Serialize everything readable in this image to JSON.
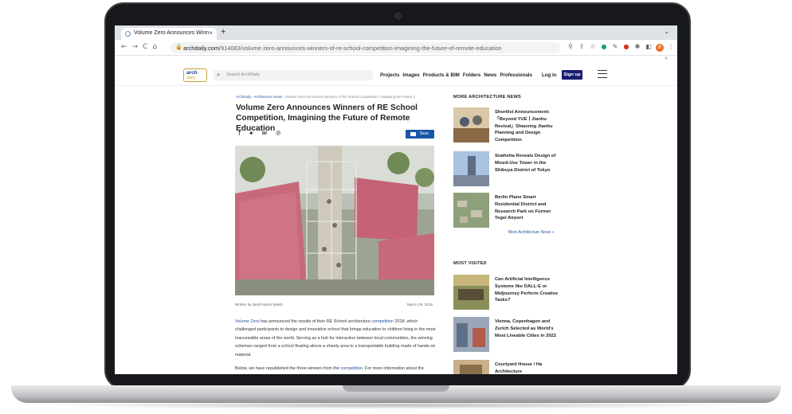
{
  "browser": {
    "tab_title": "Volume Zero Announces Winn",
    "tab_close": "×",
    "new_tab": "+",
    "url_host": "archdaily.com",
    "url_path": "/914083/volume-zero-announces-winners-of-re-school-competition-imagining-the-future-of-remote-education",
    "ext_badge": "B"
  },
  "site": {
    "logo_top": "arch",
    "logo_bottom": "daily",
    "search_placeholder": "Search ArchDaily",
    "nav": [
      "Projects",
      "Images",
      "Products & BIM",
      "Folders",
      "News",
      "Professionals"
    ],
    "login": "Log in",
    "signup": "Sign up"
  },
  "article": {
    "breadcrumb": [
      "ArchDaily",
      "Architecture News",
      "Volume Zero Announces Winners of RE School Competition, Imagining the Future o"
    ],
    "title": "Volume Zero Announces Winners of RE School Competition, Imagining the Future of Remote Education",
    "save_label": "Save",
    "byline": "Written by Niall Patrick Walsh",
    "date": "March 29, 2019",
    "p1_link1": "Volume Zero",
    "p1_text1": " has announced the results of their RE School architecture ",
    "p1_link2": "competition",
    "p1_text2": " 2018, which challenged participants to design and innovative school that brings education to children living in the most inaccessible areas of the world. Serving as a hub for interaction between local communities, the winning schemes ranged from a school floating above a shanty area to a transportable building made of hands-on material.",
    "p2_text": "Below, we have republished the three winners from the ",
    "p2_link": "competition",
    "p2_tail": ". For more information about the"
  },
  "sidebar": {
    "more_heading": "MORE ARCHITECTURE NEWS",
    "more_items": [
      "Shortlist Announcement: 「Beyond YUE丨Jianhu Revival」Shaoxing Jianhu Planning and Design Competition",
      "Snøhetta Reveals Design of Mixed-Use Tower in the Shibuya District of Tokyo",
      "Berlin Plans Smart Residential District and Research Park on Former Tegel Airport"
    ],
    "more_link": "More Architecture News »",
    "visited_heading": "MOST VISITED",
    "visited_items": [
      "Can Artificial Intelligence Systems like DALL-E or Midjourney Perform Creative Tasks?",
      "Vienna, Copenhagen and Zurich Selected as World's Most Liveable Cities in 2022",
      "Courtyard House / Ha Architecture"
    ]
  },
  "icons": {
    "back": "back-arrow-icon",
    "share": [
      "facebook-icon",
      "twitter-icon",
      "email-icon",
      "pinterest-icon"
    ],
    "accent_color": "#1a56a8",
    "signup_color": "#1a1f71"
  }
}
